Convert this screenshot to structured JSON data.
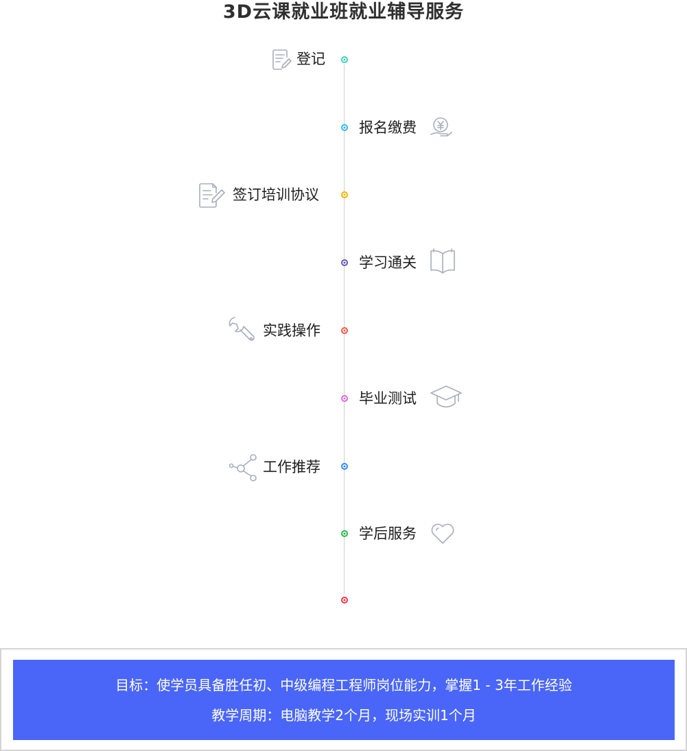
{
  "title": "3D云课就业班就业辅导服务",
  "steps": [
    {
      "label": "登记",
      "icon": "form-icon",
      "color": "#3fcfbf"
    },
    {
      "label": "报名缴费",
      "icon": "yuan-coin-hand-icon",
      "color": "#2fb9f0"
    },
    {
      "label": "签订培训协议",
      "icon": "contract-edit-icon",
      "color": "#f5b400"
    },
    {
      "label": "学习通关",
      "icon": "open-book-icon",
      "color": "#6159b3"
    },
    {
      "label": "实践操作",
      "icon": "wrench-icon",
      "color": "#f0574a"
    },
    {
      "label": "毕业测试",
      "icon": "graduation-cap-icon",
      "color": "#d96ad6"
    },
    {
      "label": "工作推荐",
      "icon": "share-icon",
      "color": "#2f8af5"
    },
    {
      "label": "学后服务",
      "icon": "heart-icon",
      "color": "#24b84a"
    }
  ],
  "end_dot_color": "#ee3a4a",
  "info": {
    "goal": "目标：使学员具备胜任初、中级编程工程师岗位能力，掌握1 - 3年工作经验",
    "period": "教学周期：电脑教学2个月，现场实训1个月"
  },
  "colors": {
    "accent_blue": "#4a66f8",
    "timeline": "#cfcfcf",
    "icon_gray": "#a7adbb"
  }
}
